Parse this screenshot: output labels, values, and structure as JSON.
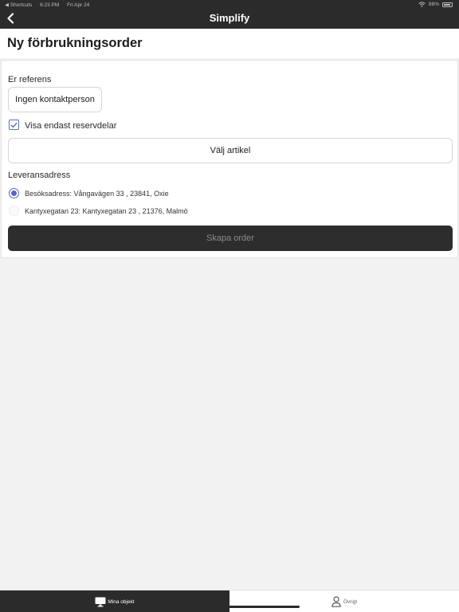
{
  "status_bar": {
    "back_app": "◀ Shortcuts",
    "time": "6:23 PM",
    "date": "Fri Apr 24",
    "battery": "88%",
    "battery_level": 0.88
  },
  "nav": {
    "title": "Simplify",
    "back_icon": "chevron-left-icon"
  },
  "page": {
    "title": "Ny förbrukningsorder"
  },
  "form": {
    "reference_label": "Er referens",
    "reference_value": "Ingen kontaktperson",
    "checkbox_label": "Visa endast reservdelar",
    "checkbox_checked": true,
    "select_article_label": "Välj artikel",
    "delivery_label": "Leveransadress",
    "addresses": [
      {
        "label": "Besöksadress: Vångavägen 33 , 23841, Oxie",
        "selected": true
      },
      {
        "label": "Kantyxegatan 23: Kantyxegatan 23 , 21376, Malmö",
        "selected": false
      }
    ],
    "submit_label": "Skapa order"
  },
  "tabbar": {
    "items": [
      {
        "label": "Mina objekt",
        "icon": "monitor-icon",
        "active": true
      },
      {
        "label": "Övrigt",
        "icon": "person-icon",
        "active": false
      }
    ]
  },
  "colors": {
    "header": "#2b2b2b",
    "accent": "#5566c2",
    "background": "#f2f2f2"
  }
}
